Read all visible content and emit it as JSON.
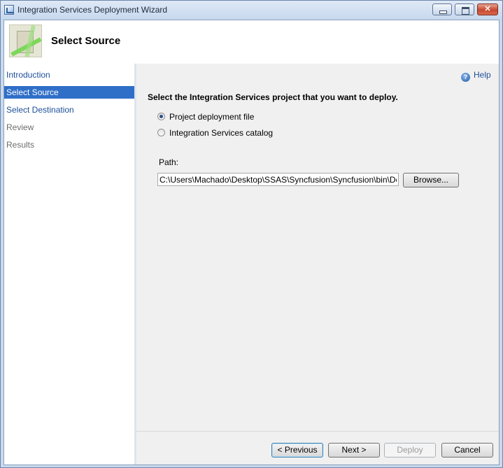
{
  "window": {
    "title": "Integration Services Deployment Wizard",
    "controls": {
      "minimize_icon": "minimize-icon",
      "maximize_icon": "maximize-icon",
      "close_icon": "close-icon",
      "close_glyph": "✕"
    }
  },
  "header": {
    "title": "Select Source",
    "icon": "wizard-banner-icon"
  },
  "nav": {
    "items": [
      {
        "label": "Introduction",
        "state": "link"
      },
      {
        "label": "Select Source",
        "state": "selected"
      },
      {
        "label": "Select Destination",
        "state": "link"
      },
      {
        "label": "Review",
        "state": "disabled"
      },
      {
        "label": "Results",
        "state": "disabled"
      }
    ]
  },
  "help": {
    "label": "Help",
    "icon": "help-icon",
    "glyph": "?"
  },
  "main": {
    "prompt": "Select the Integration Services project that you want to deploy.",
    "options": [
      {
        "label": "Project deployment file",
        "checked": true
      },
      {
        "label": "Integration Services catalog",
        "checked": false
      }
    ],
    "path_label": "Path:",
    "path_value": "C:\\Users\\Machado\\Desktop\\SSAS\\Syncfusion\\Syncfusion\\bin\\Development\\Syncfusion.ispac",
    "browse_label": "Browse..."
  },
  "footer": {
    "previous_label": "< Previous",
    "next_label": "Next >",
    "deploy_label": "Deploy",
    "cancel_label": "Cancel"
  },
  "colors": {
    "selection": "#2f6fc8",
    "link": "#1e4f9a",
    "disabled_text": "#6d6d6d"
  }
}
